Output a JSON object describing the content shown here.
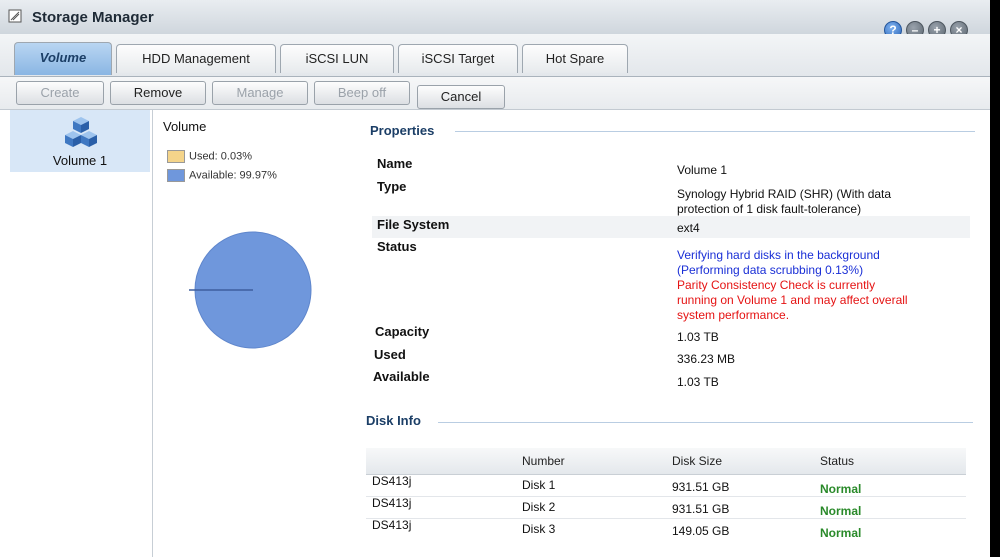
{
  "window": {
    "title": "Storage Manager"
  },
  "window_buttons": [
    {
      "name": "help-button",
      "glyph": "?"
    },
    {
      "name": "minimize-button",
      "glyph": "–"
    },
    {
      "name": "maximize-button",
      "glyph": "+"
    },
    {
      "name": "close-button",
      "glyph": "×"
    }
  ],
  "tabs": [
    {
      "label": "Volume",
      "active": true
    },
    {
      "label": "HDD Management",
      "active": false
    },
    {
      "label": "iSCSI LUN",
      "active": false
    },
    {
      "label": "iSCSI Target",
      "active": false
    },
    {
      "label": "Hot Spare",
      "active": false
    }
  ],
  "toolbar": {
    "create": "Create",
    "remove": "Remove",
    "manage": "Manage",
    "beep_off": "Beep off",
    "cancel": "Cancel"
  },
  "sidebar": {
    "items": [
      {
        "label": "Volume 1",
        "icon": "volume-cubes-icon"
      }
    ]
  },
  "chart_data": {
    "type": "pie",
    "title": "Volume",
    "slices": [
      {
        "name": "Used: 0.03%",
        "value": 0.03,
        "color": "#f4d48a"
      },
      {
        "name": "Available: 99.97%",
        "value": 99.97,
        "color": "#6f97dc"
      }
    ]
  },
  "properties": {
    "heading": "Properties",
    "name_label": "Name",
    "name_value": "Volume 1",
    "type_label": "Type",
    "type_value_1": "Synology Hybrid RAID (SHR) (With data",
    "type_value_2": "protection of 1 disk fault-tolerance)",
    "fs_label": "File System",
    "fs_value": "ext4",
    "status_label": "Status",
    "status_blue_1": "Verifying hard disks in the background",
    "status_blue_2": "(Performing data scrubbing 0.13%)",
    "status_red_1": "Parity Consistency Check is currently",
    "status_red_2": "running on Volume 1 and may affect overall",
    "status_red_3": "system performance.",
    "capacity_label": "Capacity",
    "capacity_value": "1.03 TB",
    "used_label": "Used",
    "used_value": "336.23 MB",
    "available_label": "Available",
    "available_value": "1.03 TB"
  },
  "disk_info": {
    "heading": "Disk Info",
    "columns": [
      "",
      "Number",
      "Disk Size",
      "Status"
    ],
    "rows": [
      {
        "model": "DS413j",
        "number": "Disk 1",
        "size": "931.51 GB",
        "status": "Normal"
      },
      {
        "model": "DS413j",
        "number": "Disk 2",
        "size": "931.51 GB",
        "status": "Normal"
      },
      {
        "model": "DS413j",
        "number": "Disk 3",
        "size": "149.05 GB",
        "status": "Normal"
      }
    ]
  },
  "colors": {
    "accent": "#1b3e66",
    "status_blue": "#1a2fd6",
    "status_red": "#e51313",
    "status_ok": "#2a8a2a"
  }
}
